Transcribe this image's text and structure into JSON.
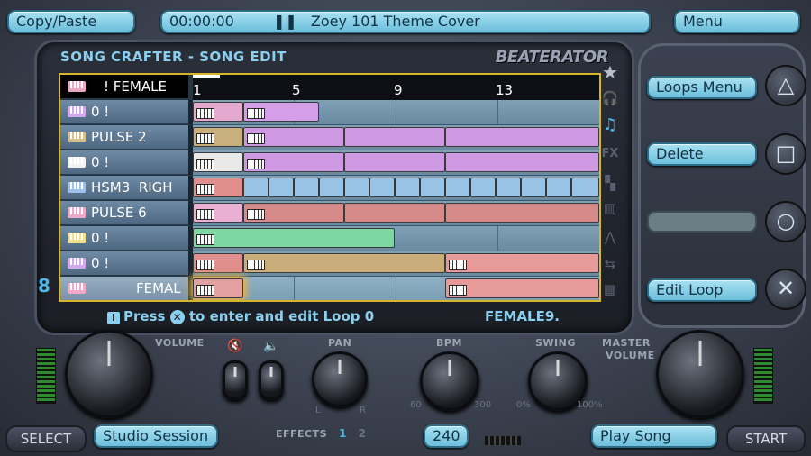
{
  "top": {
    "copy_paste": "Copy/Paste",
    "time": "00:00:00",
    "song_title": "Zoey 101 Theme Cover",
    "menu": "Menu"
  },
  "panel": {
    "title": "SONG CRAFTER - SONG EDIT",
    "brand": "BEATERATOR",
    "ruler_marks": [
      "1",
      "5",
      "9",
      "13"
    ],
    "rows": [
      {
        "label": "! FEMALE",
        "icon_color": "#e9a9c3"
      },
      {
        "label": "0 !",
        "icon_color": "#d2a8ef"
      },
      {
        "label": "PULSE 2",
        "icon_color": "#d9c18f"
      },
      {
        "label": "0 !",
        "icon_color": "#f2f2f2"
      },
      {
        "label": "HSM3  RIGH",
        "icon_color": "#9fc2ea"
      },
      {
        "label": "PULSE 6",
        "icon_color": "#f0a9c8"
      },
      {
        "label": "0 !",
        "icon_color": "#f3e08e"
      },
      {
        "label": "0 !",
        "icon_color": "#d2a8ef"
      },
      {
        "label": "FEMAL",
        "icon_color": "#f0a9c8"
      }
    ],
    "hint_prefix": "Press",
    "hint_suffix": "to enter and edit Loop 0",
    "loop_name": "FEMALE9."
  },
  "right": {
    "loops_menu": "Loops Menu",
    "delete": "Delete",
    "edit_loop": "Edit Loop",
    "triangle": "△",
    "square": "□",
    "circle": "○",
    "cross": "✕"
  },
  "bottom": {
    "volume": "VOLUME",
    "pan": "PAN",
    "bpm": "BPM",
    "swing": "SWING",
    "master_volume_1": "MASTER",
    "master_volume_2": "VOLUME",
    "effects": "EFFECTS",
    "effects_1": "1",
    "effects_2": "2",
    "pan_l": "L",
    "pan_r": "R",
    "bpm_min": "60",
    "bpm_max": "300",
    "swing_min": "0%",
    "swing_max": "100%",
    "select": "SELECT",
    "studio_session": "Studio Session",
    "bpm_value": "240",
    "play_song": "Play Song",
    "start": "START",
    "side_number": "8"
  }
}
